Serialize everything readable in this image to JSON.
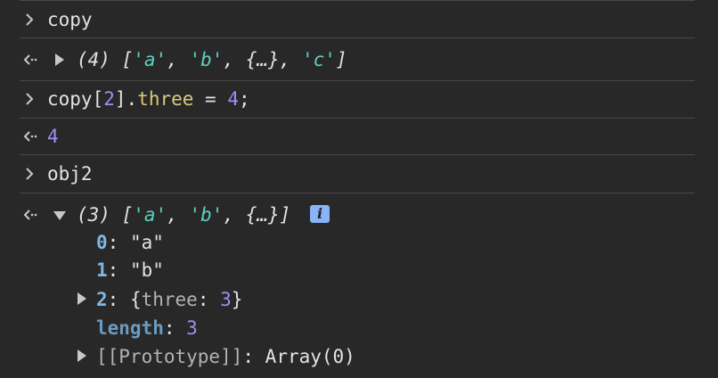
{
  "console": {
    "entries": [
      {
        "kind": "input",
        "text": "copy"
      },
      {
        "kind": "result",
        "count": "(4)",
        "items": [
          "'a'",
          "'b'",
          "{…}",
          "'c'"
        ]
      },
      {
        "kind": "input",
        "tokens": {
          "obj": "copy",
          "lb": "[",
          "idx": "2",
          "rb": "].",
          "prop": "three",
          "eq": " = ",
          "val": "4",
          "semi": ";"
        }
      },
      {
        "kind": "result",
        "text": "4"
      },
      {
        "kind": "input",
        "text": "obj2"
      },
      {
        "kind": "result",
        "count": "(3)",
        "items": [
          "'a'",
          "'b'",
          "{…}"
        ],
        "info": "i"
      }
    ],
    "tree": {
      "rows": [
        {
          "key": "0",
          "sep": ": ",
          "value": "\"a\""
        },
        {
          "key": "1",
          "sep": ": ",
          "value": "\"b\""
        },
        {
          "key": "2",
          "sep": ": ",
          "value_open": "{",
          "value_key": "three",
          "value_sep": ": ",
          "value_num": "3",
          "value_close": "}"
        },
        {
          "key": "length",
          "sep": ": ",
          "value": "3"
        },
        {
          "key": "[[Prototype]]",
          "sep": ": ",
          "value": "Array(0)"
        }
      ]
    }
  },
  "icons": {
    "prompt": "chevron-right-icon",
    "result": "return-arrow-icon",
    "expand": "expand-triangle-icon",
    "collapse": "collapse-triangle-icon",
    "info": "info-icon"
  },
  "colors": {
    "background": "#282828",
    "string": "#5bd1c1",
    "number": "#9f8ef2",
    "property": "#d9c97b",
    "key": "#7eb8e6",
    "info_badge": "#8ab4f8"
  }
}
